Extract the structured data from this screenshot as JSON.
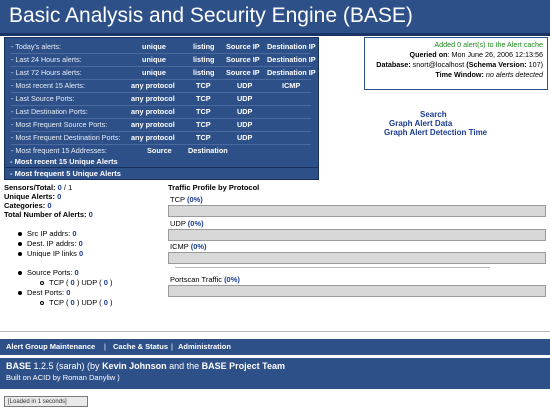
{
  "app": {
    "title": "Basic Analysis and Security Engine (BASE)"
  },
  "summary": {
    "rows": [
      {
        "label": "- Today's alerts:",
        "cols": [
          "unique",
          "listing",
          "Source IP",
          "Destination IP"
        ]
      },
      {
        "label": "- Last 24 Hours alerts:",
        "cols": [
          "unique",
          "listing",
          "Source IP",
          "Destination IP"
        ]
      },
      {
        "label": "- Last 72 Hours alerts:",
        "cols": [
          "unique",
          "listing",
          "Source IP",
          "Destination IP"
        ]
      },
      {
        "label": "- Most recent 15 Alerts:",
        "cols": [
          "any protocol",
          "TCP",
          "UDP",
          "ICMP"
        ]
      },
      {
        "label": "- Last Source Ports:",
        "cols": [
          "any protocol",
          "TCP",
          "UDP"
        ]
      },
      {
        "label": "- Last Destination Ports:",
        "cols": [
          "any protocol",
          "TCP",
          "UDP"
        ]
      },
      {
        "label": "- Most Frequent Source Ports:",
        "cols": [
          "any protocol",
          "TCP",
          "UDP"
        ]
      },
      {
        "label": "- Most Frequent Destination Ports:",
        "cols": [
          "any protocol",
          "TCP",
          "UDP"
        ]
      },
      {
        "label": "- Most frequent 15 Addresses:",
        "cols": [
          "Source",
          "Destination"
        ]
      }
    ],
    "most_recent_unique": "- Most recent 15 Unique Alerts",
    "most_frequent_unique": "- Most frequent 5 Unique Alerts"
  },
  "info": {
    "cache_msg": "Added 0 alert(s) to the Alert cache",
    "queried_label": "Queried on",
    "queried_value": ": Mon June 26, 2006 12:13:56",
    "database_label": "Database:",
    "database_value": "snort@localhost",
    "schema_label": "(Schema Version:",
    "schema_value": "107)",
    "window_label": "Time Window:",
    "window_value": "no alerts detected"
  },
  "graph_links": {
    "search": "Search",
    "graph_alert": "Graph Alert Data",
    "graph_detection": "Graph Alert Detection Time"
  },
  "stats": {
    "sensors_label": "Sensors/Total:",
    "sensors_value": "0",
    "sensors_total": "1",
    "unique_label": "Unique Alerts:",
    "unique_value": "0",
    "categories_label": "Categories:",
    "categories_value": "0",
    "total_label": "Total Number of Alerts:",
    "total_value": "0",
    "src_ip_label": "Src IP addrs:",
    "src_ip_value": "0",
    "dest_ip_label": "Dest. IP addrs:",
    "dest_ip_value": "0",
    "unique_ip_label": "Unique IP links",
    "unique_ip_value": "0",
    "source_ports_label": "Source Ports:",
    "source_ports_value": "0",
    "src_tcp_label": "TCP (",
    "src_tcp_value": "0",
    "src_udp_label": ")  UDP (",
    "src_udp_value": "0",
    "dest_ports_label": "Dest Ports:",
    "dest_ports_value": "0",
    "dst_tcp_label": "TCP (",
    "dst_tcp_value": "0",
    "dst_udp_label": ")  UDP (",
    "dst_udp_value": "0",
    "close_paren": ")"
  },
  "traffic": {
    "title": "Traffic Profile by Protocol",
    "tcp_label": "TCP",
    "tcp_pct": "(0%)",
    "tcp_fraction": 0,
    "udp_label": "UDP",
    "udp_pct": "(0%)",
    "udp_fraction": 0,
    "icmp_label": "ICMP",
    "icmp_pct": "(0%)",
    "icmp_fraction": 0,
    "portscan_label": "Portscan Traffic",
    "portscan_pct": "(0%)",
    "portscan_fraction": 0
  },
  "nav": {
    "alert_group": "Alert Group Maintenance",
    "cache_status": "Cache & Status",
    "administration": "Administration",
    "sep": "|"
  },
  "footer": {
    "base": "BASE",
    "version": " 1.2.5 (sarah)",
    "by": " (by ",
    "author": "Kevin Johnson",
    "and_the": " and the ",
    "team": "BASE Project Team",
    "built_on": "Built on ACID by Roman Danyliw )",
    "loaded": "[Loaded in 1 seconds]"
  },
  "colors": {
    "header_bg": "#2e5088",
    "link_blue": "#1a3b8f",
    "green": "#1f8a1f"
  }
}
